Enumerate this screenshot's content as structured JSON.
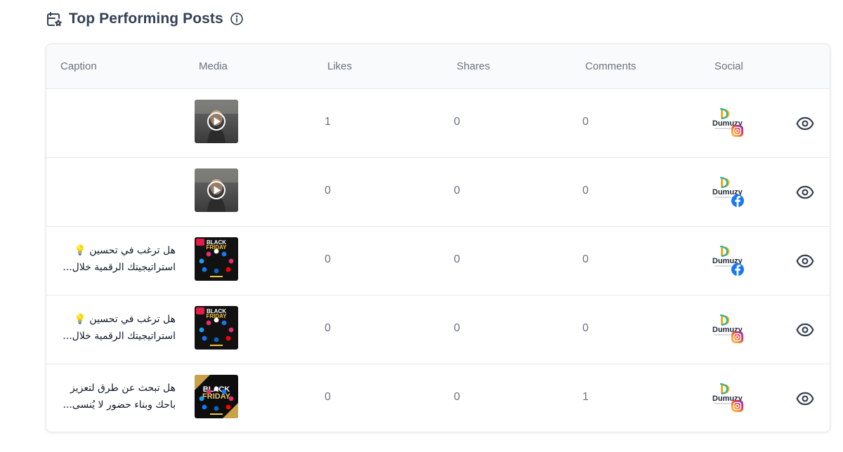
{
  "widget": {
    "title": "Top Performing Posts",
    "title_icon": "calendar-star-icon",
    "info_icon": "info-circle-icon"
  },
  "table": {
    "columns": [
      "Caption",
      "Media",
      "Likes",
      "Shares",
      "Comments",
      "Social"
    ],
    "rows": [
      {
        "caption": [
          "",
          ""
        ],
        "media": "video",
        "likes": "1",
        "shares": "0",
        "comments": "0",
        "network": "instagram"
      },
      {
        "caption": [
          "",
          ""
        ],
        "media": "video",
        "likes": "0",
        "shares": "0",
        "comments": "0",
        "network": "facebook"
      },
      {
        "caption": [
          "هل ترغب في تحسين 💡",
          "استراتيجيتك الرقمية خلال..."
        ],
        "media": "black-friday-dark",
        "likes": "0",
        "shares": "0",
        "comments": "0",
        "network": "facebook"
      },
      {
        "caption": [
          "هل ترغب في تحسين 💡",
          "استراتيجيتك الرقمية خلال..."
        ],
        "media": "black-friday-dark",
        "likes": "0",
        "shares": "0",
        "comments": "0",
        "network": "instagram"
      },
      {
        "caption": [
          "هل تبحث عن طرق لتعزيز",
          "باحك وبناء حضور لا يُنسى..."
        ],
        "media": "black-friday-gold",
        "likes": "0",
        "shares": "0",
        "comments": "1",
        "network": "instagram"
      }
    ]
  },
  "media_labels": {
    "black_line": "BLACK",
    "friday_line": "FRIDAY"
  },
  "brand": {
    "logo_letter": "D",
    "logo_name": "Dumuzy"
  },
  "colors": {
    "instagram": "#d6249f",
    "facebook": "#1877f2",
    "brand_orange": "#f59e0b",
    "brand_teal": "#14b8a6"
  }
}
